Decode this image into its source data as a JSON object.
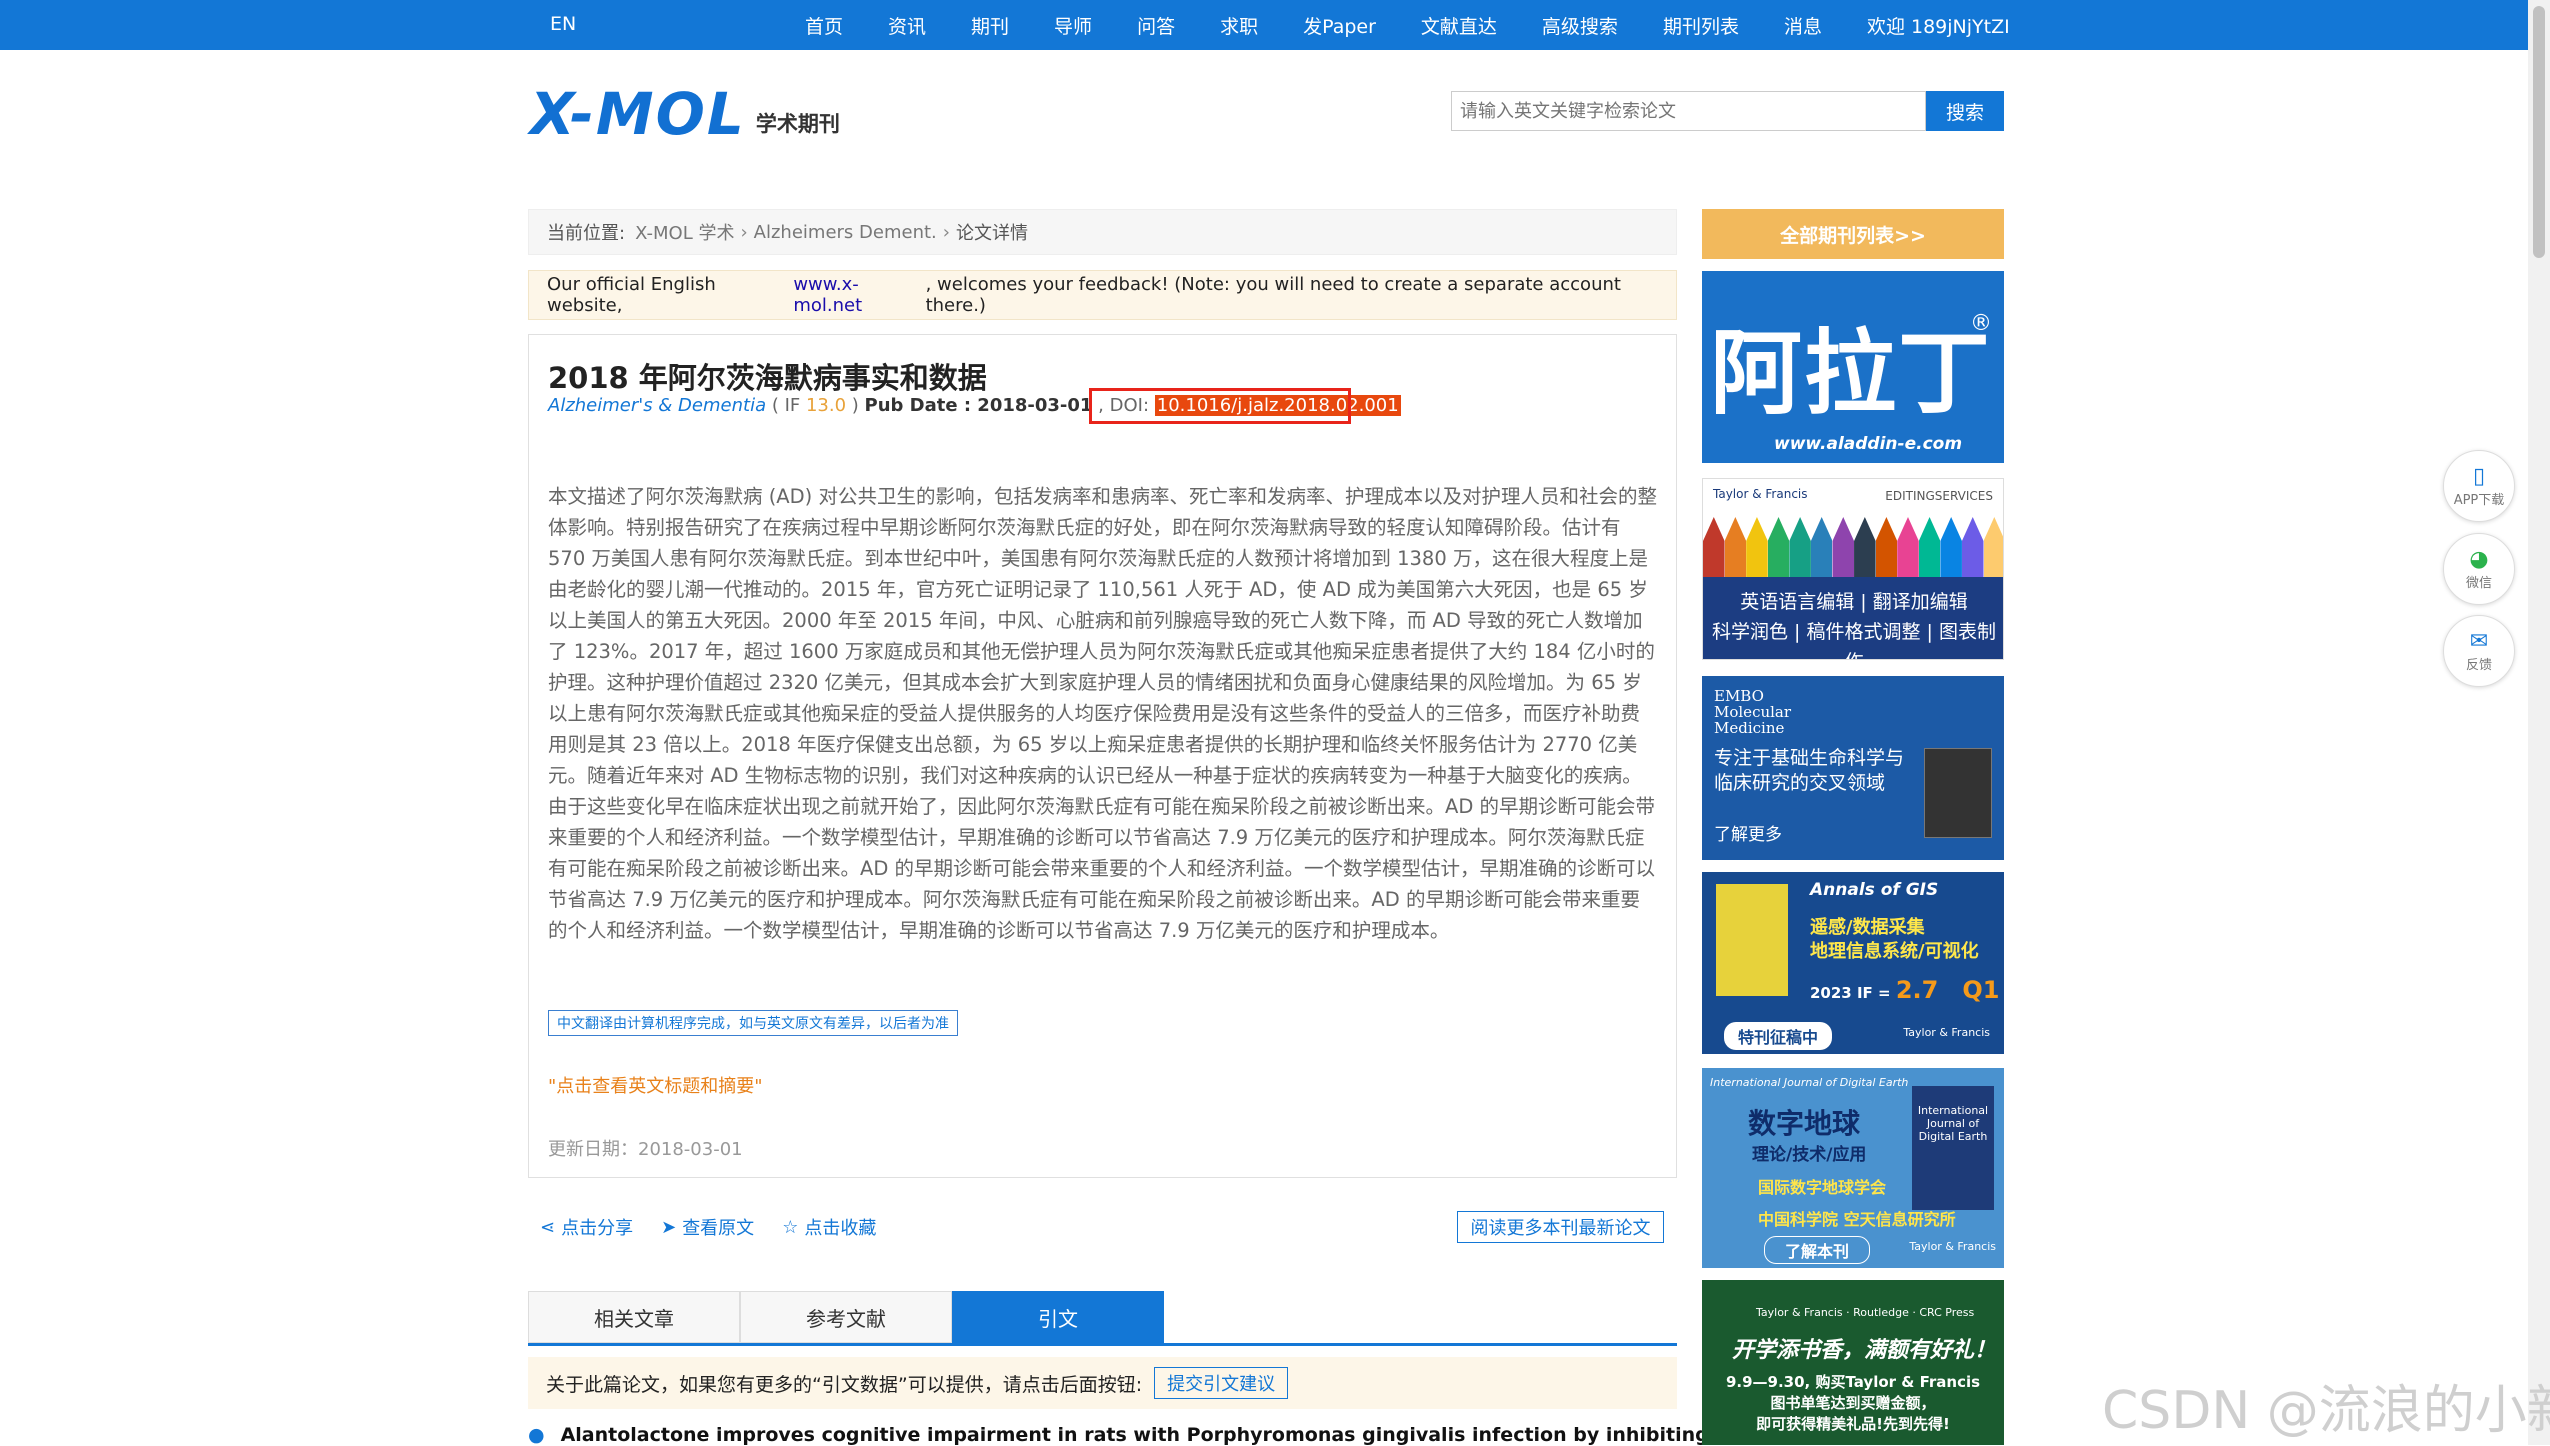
{
  "topbar": {
    "lang": "EN",
    "nav": [
      "首页",
      "资讯",
      "期刊",
      "导师",
      "问答",
      "求职",
      "发Paper",
      "文献直达",
      "高级搜索",
      "期刊列表",
      "消息"
    ],
    "user": "欢迎 189jNjYtZI"
  },
  "header": {
    "logo_mark": "X-MOL",
    "logo_sub": "学术期刊",
    "search_placeholder": "请输入英文关键字检索论文",
    "search_button": "搜索"
  },
  "breadcrumb": {
    "prefix": "当前位置:",
    "items": [
      "X-MOL 学术",
      "Alzheimers Dement.",
      "论文详情"
    ]
  },
  "notice": {
    "before": "Our official English website, ",
    "link": "www.x-mol.net",
    "after": ", welcomes your feedback! (Note: you will need to create a separate account there.)"
  },
  "article": {
    "title": "2018 年阿尔茨海默病事实和数据",
    "journal": "Alzheimer's & Dementia",
    "if_label": " ( IF ",
    "if_value": "13.0",
    "if_close": " ) ",
    "pub_date": "Pub Date : 2018-03-01",
    "doi_label": " , DOI: ",
    "doi": "10.1016/j.jalz.2018.02.001",
    "abstract": "本文描述了阿尔茨海默病 (AD) 对公共卫生的影响，包括发病率和患病率、死亡率和发病率、护理成本以及对护理人员和社会的整体影响。特别报告研究了在疾病过程中早期诊断阿尔茨海默氏症的好处，即在阿尔茨海默病导致的轻度认知障碍阶段。估计有 570 万美国人患有阿尔茨海默氏症。到本世纪中叶，美国患有阿尔茨海默氏症的人数预计将增加到 1380 万，这在很大程度上是由老龄化的婴儿潮一代推动的。2015 年，官方死亡证明记录了 110,561 人死于 AD，使 AD 成为美国第六大死因，也是 65 岁以上美国人的第五大死因。2000 年至 2015 年间，中风、心脏病和前列腺癌导致的死亡人数下降，而 AD 导致的死亡人数增加了 123%。2017 年，超过 1600 万家庭成员和其他无偿护理人员为阿尔茨海默氏症或其他痴呆症患者提供了大约 184 亿小时的护理。这种护理价值超过 2320 亿美元，但其成本会扩大到家庭护理人员的情绪困扰和负面身心健康结果的风险增加。为 65 岁以上患有阿尔茨海默氏症或其他痴呆症的受益人提供服务的人均医疗保险费用是没有这些条件的受益人的三倍多，而医疗补助费用则是其 23 倍以上。2018 年医疗保健支出总额，为 65 岁以上痴呆症患者提供的长期护理和临终关怀服务估计为 2770 亿美元。随着近年来对 AD 生物标志物的识别，我们对这种疾病的认识已经从一种基于症状的疾病转变为一种基于大脑变化的疾病。由于这些变化早在临床症状出现之前就开始了，因此阿尔茨海默氏症有可能在痴呆阶段之前被诊断出来。AD 的早期诊断可能会带来重要的个人和经济利益。一个数学模型估计，早期准确的诊断可以节省高达 7.9 万亿美元的医疗和护理成本。阿尔茨海默氏症有可能在痴呆阶段之前被诊断出来。AD 的早期诊断可能会带来重要的个人和经济利益。一个数学模型估计，早期准确的诊断可以节省高达 7.9 万亿美元的医疗和护理成本。阿尔茨海默氏症有可能在痴呆阶段之前被诊断出来。AD 的早期诊断可能会带来重要的个人和经济利益。一个数学模型估计，早期准确的诊断可以节省高达 7.9 万亿美元的医疗和护理成本。",
    "translation_note": "中文翻译由计算机程序完成，如与英文原文有差异，以后者为准",
    "view_english": "\"点击查看英文标题和摘要\"",
    "updated": "更新日期：2018-03-01"
  },
  "actions": {
    "share": "点击分享",
    "view_original": "查看原文",
    "favorite": "点击收藏",
    "more_papers": "阅读更多本刊最新论文"
  },
  "tabs": [
    {
      "label": "相关文章",
      "active": false
    },
    {
      "label": "参考文献",
      "active": false
    },
    {
      "label": "引文",
      "active": true
    }
  ],
  "citation": {
    "prompt": "关于此篇论文，如果您有更多的“引文数据”可以提供，请点击后面按钮:",
    "button": "提交引文建议",
    "first_item": "Alantolactone improves cognitive impairment in rats with Porphyromonas gingivalis infection by inhibiting"
  },
  "sidebar": {
    "all_journals": "全部期刊列表>>",
    "aladdin": {
      "brand": "阿拉丁",
      "reg": "®",
      "url": "www.aladdin-e.com"
    },
    "tf_edit": {
      "brand": "Taylor & Francis",
      "service": "EDITINGSERVICES",
      "line1": "英语语言编辑 | 翻译加编辑",
      "line2": "科学润色 | 稿件格式调整 | 图表制作"
    },
    "embo": {
      "name_1": "EMBO",
      "name_2": "Molecular",
      "name_3": "Medicine",
      "line1": "专注于基础生命科学与",
      "line2": "临床研究的交叉领域",
      "more": "了解更多"
    },
    "gis": {
      "title": "Annals of GIS",
      "line1": "遥感/数据采集",
      "line2": "地理信息系统/可视化",
      "if_label": "2023 IF = ",
      "if_value": "2.7",
      "quartile": "Q1",
      "badge": "特刊征稿中",
      "publisher": "Taylor & Francis"
    },
    "de": {
      "header": "International Journal of Digital Earth",
      "title": "数字地球",
      "sub": "理论/技术/应用",
      "org1": "国际数字地球学会",
      "org2": "中国科学院 空天信息研究所",
      "cover": "International Journal of Digital Earth",
      "btn": "了解本刊",
      "publisher": "Taylor & Francis"
    },
    "bs": {
      "brands": "Taylor & Francis · Routledge · CRC Press",
      "title": "开学添书香，满额有好礼！",
      "line1": "9.9—9.30, 购买Taylor & Francis",
      "line2": "图书单笔达到买赠金额，",
      "line3": "即可获得精美礼品!先到先得!"
    }
  },
  "floats": [
    {
      "icon": "▯",
      "label": "APP下载"
    },
    {
      "icon": "◕",
      "label": "微信"
    },
    {
      "icon": "✉",
      "label": "反馈"
    }
  ],
  "watermark": "CSDN @流浪的小新",
  "colors": {
    "brand": "#1377d6",
    "accent": "#e8a23a",
    "doi_highlight": "#e8480e"
  }
}
